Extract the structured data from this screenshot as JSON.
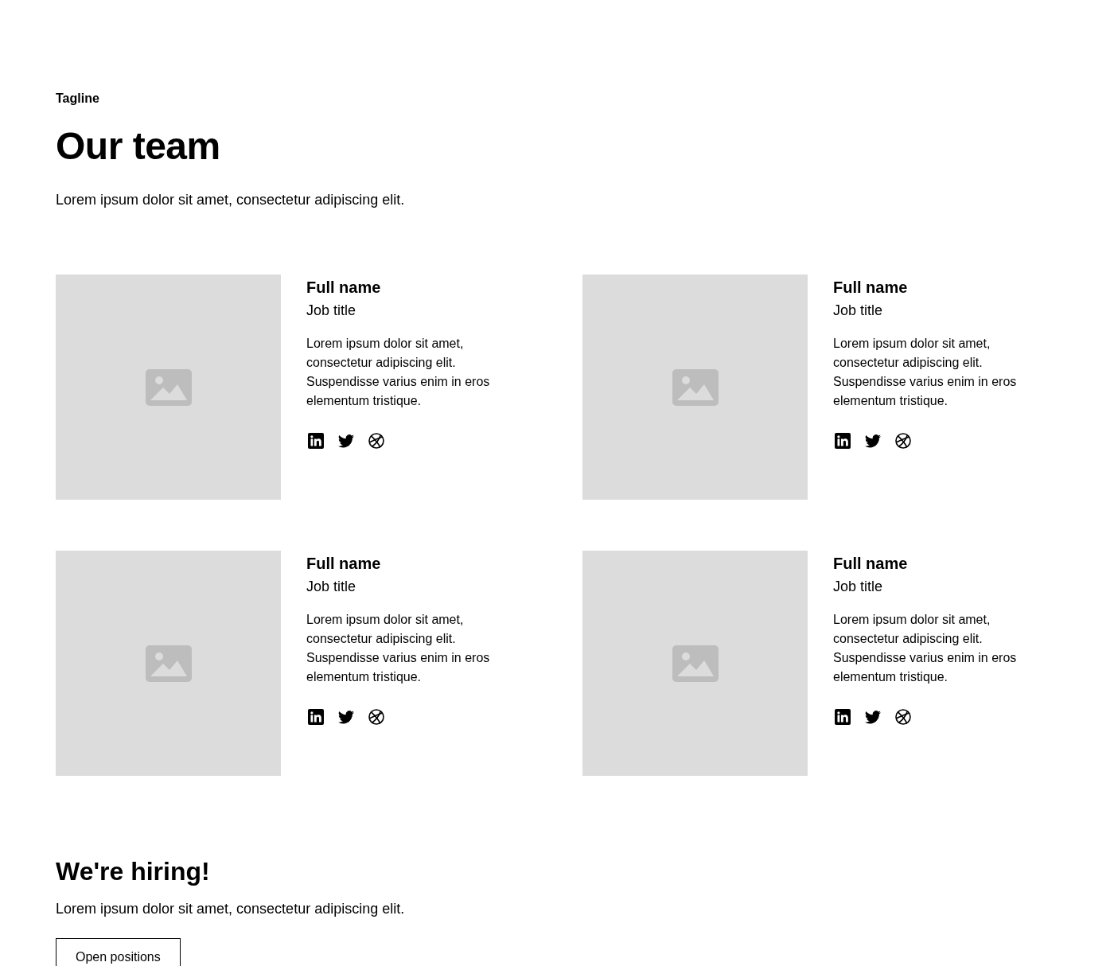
{
  "header": {
    "tagline": "Tagline",
    "title": "Our team",
    "description": "Lorem ipsum dolor sit amet, consectetur adipiscing elit."
  },
  "members": [
    {
      "name": "Full name",
      "job_title": "Job title",
      "bio": "Lorem ipsum dolor sit amet, consectetur adipiscing elit. Suspendisse varius enim in eros elementum tristique.",
      "socials": [
        {
          "kind": "linkedin"
        },
        {
          "kind": "twitter"
        },
        {
          "kind": "dribbble"
        }
      ]
    },
    {
      "name": "Full name",
      "job_title": "Job title",
      "bio": "Lorem ipsum dolor sit amet, consectetur adipiscing elit. Suspendisse varius enim in eros elementum tristique.",
      "socials": [
        {
          "kind": "linkedin"
        },
        {
          "kind": "twitter"
        },
        {
          "kind": "dribbble"
        }
      ]
    },
    {
      "name": "Full name",
      "job_title": "Job title",
      "bio": "Lorem ipsum dolor sit amet, consectetur adipiscing elit. Suspendisse varius enim in eros elementum tristique.",
      "socials": [
        {
          "kind": "linkedin"
        },
        {
          "kind": "twitter"
        },
        {
          "kind": "dribbble"
        }
      ]
    },
    {
      "name": "Full name",
      "job_title": "Job title",
      "bio": "Lorem ipsum dolor sit amet, consectetur adipiscing elit. Suspendisse varius enim in eros elementum tristique.",
      "socials": [
        {
          "kind": "linkedin"
        },
        {
          "kind": "twitter"
        },
        {
          "kind": "dribbble"
        }
      ]
    }
  ],
  "hiring": {
    "title": "We're hiring!",
    "description": "Lorem ipsum dolor sit amet, consectetur adipiscing elit.",
    "button": "Open positions"
  }
}
